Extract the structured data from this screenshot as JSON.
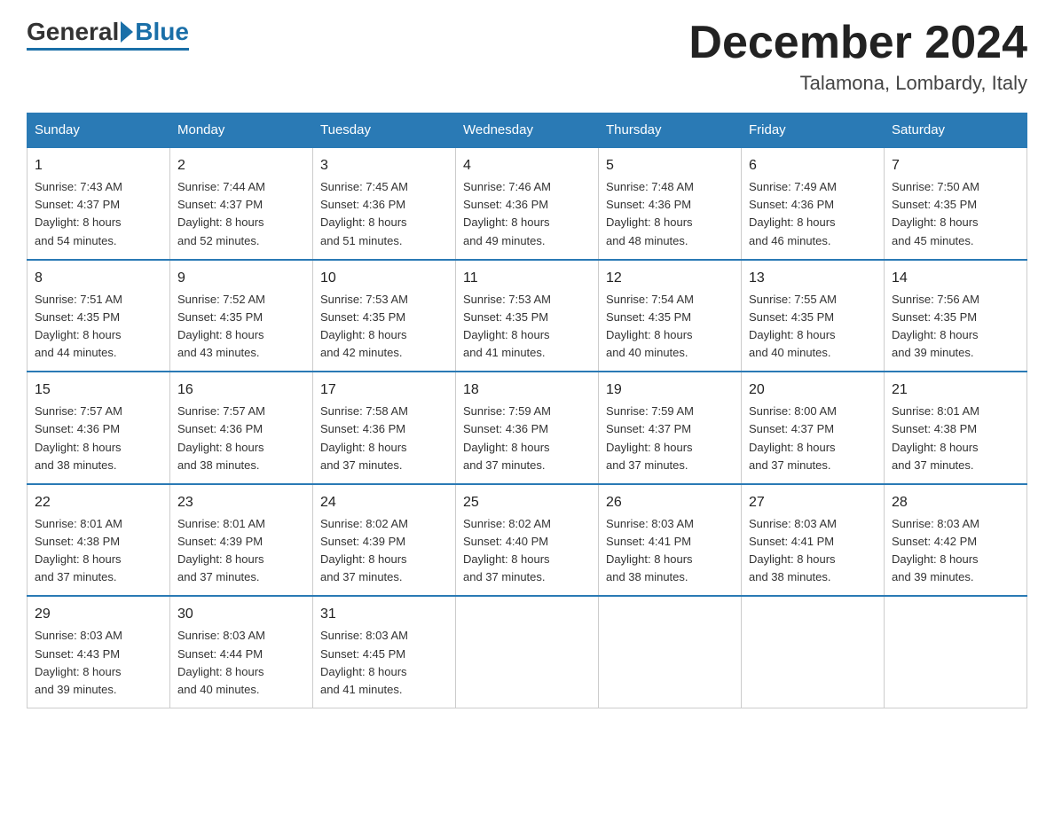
{
  "logo": {
    "general": "General",
    "blue": "Blue"
  },
  "title": "December 2024",
  "subtitle": "Talamona, Lombardy, Italy",
  "days_of_week": [
    "Sunday",
    "Monday",
    "Tuesday",
    "Wednesday",
    "Thursday",
    "Friday",
    "Saturday"
  ],
  "weeks": [
    [
      {
        "num": "1",
        "sunrise": "7:43 AM",
        "sunset": "4:37 PM",
        "daylight": "8 hours and 54 minutes."
      },
      {
        "num": "2",
        "sunrise": "7:44 AM",
        "sunset": "4:37 PM",
        "daylight": "8 hours and 52 minutes."
      },
      {
        "num": "3",
        "sunrise": "7:45 AM",
        "sunset": "4:36 PM",
        "daylight": "8 hours and 51 minutes."
      },
      {
        "num": "4",
        "sunrise": "7:46 AM",
        "sunset": "4:36 PM",
        "daylight": "8 hours and 49 minutes."
      },
      {
        "num": "5",
        "sunrise": "7:48 AM",
        "sunset": "4:36 PM",
        "daylight": "8 hours and 48 minutes."
      },
      {
        "num": "6",
        "sunrise": "7:49 AM",
        "sunset": "4:36 PM",
        "daylight": "8 hours and 46 minutes."
      },
      {
        "num": "7",
        "sunrise": "7:50 AM",
        "sunset": "4:35 PM",
        "daylight": "8 hours and 45 minutes."
      }
    ],
    [
      {
        "num": "8",
        "sunrise": "7:51 AM",
        "sunset": "4:35 PM",
        "daylight": "8 hours and 44 minutes."
      },
      {
        "num": "9",
        "sunrise": "7:52 AM",
        "sunset": "4:35 PM",
        "daylight": "8 hours and 43 minutes."
      },
      {
        "num": "10",
        "sunrise": "7:53 AM",
        "sunset": "4:35 PM",
        "daylight": "8 hours and 42 minutes."
      },
      {
        "num": "11",
        "sunrise": "7:53 AM",
        "sunset": "4:35 PM",
        "daylight": "8 hours and 41 minutes."
      },
      {
        "num": "12",
        "sunrise": "7:54 AM",
        "sunset": "4:35 PM",
        "daylight": "8 hours and 40 minutes."
      },
      {
        "num": "13",
        "sunrise": "7:55 AM",
        "sunset": "4:35 PM",
        "daylight": "8 hours and 40 minutes."
      },
      {
        "num": "14",
        "sunrise": "7:56 AM",
        "sunset": "4:35 PM",
        "daylight": "8 hours and 39 minutes."
      }
    ],
    [
      {
        "num": "15",
        "sunrise": "7:57 AM",
        "sunset": "4:36 PM",
        "daylight": "8 hours and 38 minutes."
      },
      {
        "num": "16",
        "sunrise": "7:57 AM",
        "sunset": "4:36 PM",
        "daylight": "8 hours and 38 minutes."
      },
      {
        "num": "17",
        "sunrise": "7:58 AM",
        "sunset": "4:36 PM",
        "daylight": "8 hours and 37 minutes."
      },
      {
        "num": "18",
        "sunrise": "7:59 AM",
        "sunset": "4:36 PM",
        "daylight": "8 hours and 37 minutes."
      },
      {
        "num": "19",
        "sunrise": "7:59 AM",
        "sunset": "4:37 PM",
        "daylight": "8 hours and 37 minutes."
      },
      {
        "num": "20",
        "sunrise": "8:00 AM",
        "sunset": "4:37 PM",
        "daylight": "8 hours and 37 minutes."
      },
      {
        "num": "21",
        "sunrise": "8:01 AM",
        "sunset": "4:38 PM",
        "daylight": "8 hours and 37 minutes."
      }
    ],
    [
      {
        "num": "22",
        "sunrise": "8:01 AM",
        "sunset": "4:38 PM",
        "daylight": "8 hours and 37 minutes."
      },
      {
        "num": "23",
        "sunrise": "8:01 AM",
        "sunset": "4:39 PM",
        "daylight": "8 hours and 37 minutes."
      },
      {
        "num": "24",
        "sunrise": "8:02 AM",
        "sunset": "4:39 PM",
        "daylight": "8 hours and 37 minutes."
      },
      {
        "num": "25",
        "sunrise": "8:02 AM",
        "sunset": "4:40 PM",
        "daylight": "8 hours and 37 minutes."
      },
      {
        "num": "26",
        "sunrise": "8:03 AM",
        "sunset": "4:41 PM",
        "daylight": "8 hours and 38 minutes."
      },
      {
        "num": "27",
        "sunrise": "8:03 AM",
        "sunset": "4:41 PM",
        "daylight": "8 hours and 38 minutes."
      },
      {
        "num": "28",
        "sunrise": "8:03 AM",
        "sunset": "4:42 PM",
        "daylight": "8 hours and 39 minutes."
      }
    ],
    [
      {
        "num": "29",
        "sunrise": "8:03 AM",
        "sunset": "4:43 PM",
        "daylight": "8 hours and 39 minutes."
      },
      {
        "num": "30",
        "sunrise": "8:03 AM",
        "sunset": "4:44 PM",
        "daylight": "8 hours and 40 minutes."
      },
      {
        "num": "31",
        "sunrise": "8:03 AM",
        "sunset": "4:45 PM",
        "daylight": "8 hours and 41 minutes."
      },
      null,
      null,
      null,
      null
    ]
  ],
  "labels": {
    "sunrise": "Sunrise:",
    "sunset": "Sunset:",
    "daylight": "Daylight:"
  }
}
